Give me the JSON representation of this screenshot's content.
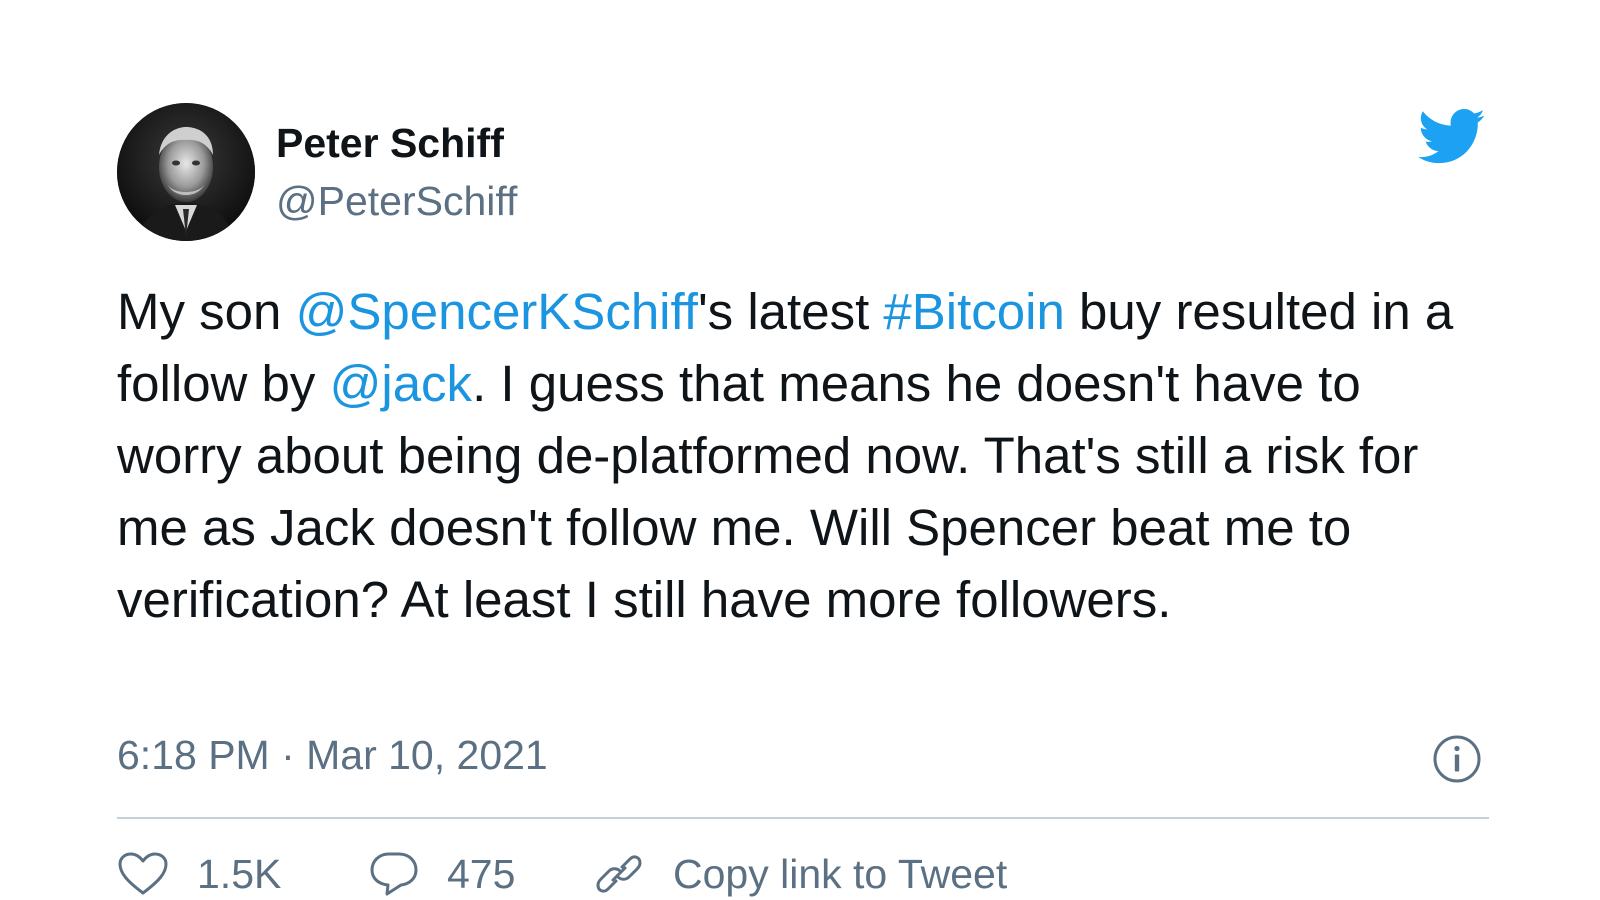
{
  "author": {
    "name": "Peter Schiff",
    "handle": "@PeterSchiff"
  },
  "icons": {
    "avatar": "avatar",
    "logo": "twitter-bird-icon",
    "info": "info-icon",
    "like": "heart-icon",
    "reply": "reply-icon",
    "copy": "link-icon"
  },
  "tweet": {
    "text_parts": [
      {
        "text": "My son ",
        "link": false
      },
      {
        "text": "@SpencerKSchiff",
        "link": true
      },
      {
        "text": "'s latest ",
        "link": false
      },
      {
        "text": "#Bitcoin",
        "link": true
      },
      {
        "text": " buy resulted in a follow by ",
        "link": false
      },
      {
        "text": "@jack",
        "link": true
      },
      {
        "text": ". I guess that means he doesn't have to worry about being de-platformed now. That's still a risk for me as Jack doesn't follow me. Will Spencer beat me to verification? At least I still have more followers.",
        "link": false
      }
    ],
    "timestamp": "6:18 PM · Mar 10, 2021"
  },
  "actions": {
    "likes": "1.5K",
    "replies": "475",
    "copy_link_label": "Copy link to Tweet"
  },
  "colors": {
    "link": "#1b95e0",
    "secondary": "#5b7083",
    "logo": "#1da1f2",
    "divider": "#c4cfd6"
  }
}
